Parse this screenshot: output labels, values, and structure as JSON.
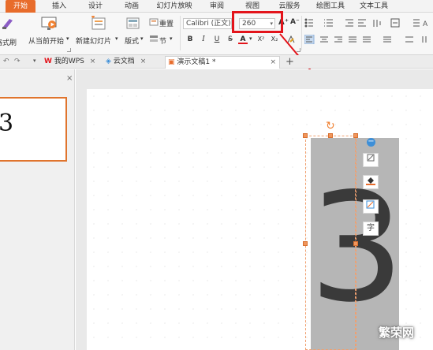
{
  "menu": {
    "tabs": [
      {
        "label": "开始",
        "active": true
      },
      {
        "label": "插入"
      },
      {
        "label": "设计"
      },
      {
        "label": "动画"
      },
      {
        "label": "幻灯片放映"
      },
      {
        "label": "审阅"
      },
      {
        "label": "视图"
      },
      {
        "label": "云服务"
      },
      {
        "label": "绘图工具"
      },
      {
        "label": "文本工具"
      }
    ]
  },
  "ribbon": {
    "format_painter_label": "格式刷",
    "from_current_label": "从当前开始",
    "new_slide_label": "新建幻灯片",
    "layout_label": "版式",
    "reset_label": "重置",
    "section_label": "节",
    "font_name": "Calibri (正文)",
    "font_size": "260",
    "bold": "B",
    "italic": "I",
    "underline": "U",
    "strike": "S",
    "font_color_glyph": "A",
    "superscript": "X²",
    "subscript": "X₂",
    "grow_font": "A⁺",
    "shrink_font": "A⁻"
  },
  "tabs": {
    "docs": [
      {
        "label": "我的WPS"
      },
      {
        "label": "云文档"
      },
      {
        "label": "演示文稿1 *"
      }
    ],
    "add": "+"
  },
  "panel": {
    "close": "×",
    "thumb_text": "3"
  },
  "slide": {
    "text": "3"
  },
  "float_tools": [
    "字"
  ],
  "watermark": "繁荣网",
  "colors": {
    "accent": "#e86c2b",
    "highlight_red": "#e3141b"
  }
}
